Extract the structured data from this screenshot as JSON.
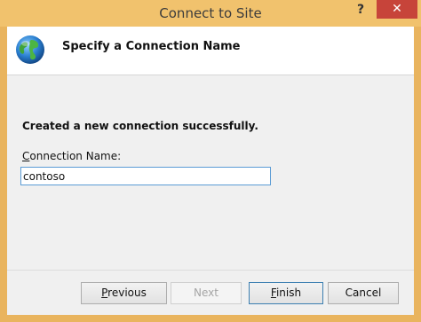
{
  "window": {
    "title": "Connect to Site",
    "help_label": "?",
    "close_label": "✕"
  },
  "header": {
    "title": "Specify a Connection Name",
    "icon": "globe-icon"
  },
  "content": {
    "message": "Created a new connection successfully.",
    "field_label_mnemonic": "C",
    "field_label_rest": "onnection Name:",
    "connection_name_value": "contoso"
  },
  "buttons": {
    "previous_mnemonic": "P",
    "previous_rest": "revious",
    "next_label": "Next",
    "finish_mnemonic": "F",
    "finish_rest": "inish",
    "cancel_label": "Cancel"
  },
  "colors": {
    "titlebar": "#f1c26d",
    "close": "#c7443a",
    "input_border": "#5b9bd5"
  }
}
